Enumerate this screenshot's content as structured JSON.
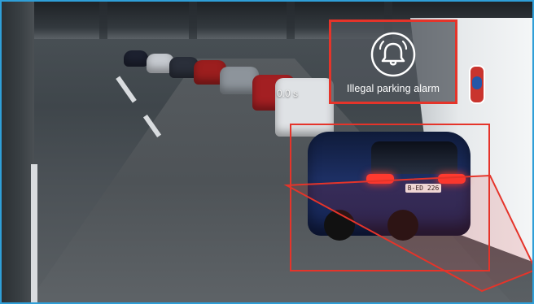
{
  "alarm": {
    "label": "Illegal parking alarm",
    "icon": "alarm-bell-icon"
  },
  "timer": {
    "value": "0.0 s"
  },
  "vehicle": {
    "plate": "B-ED 226"
  },
  "colors": {
    "alert_red": "#e5342a",
    "frame_blue": "#2f9fd8",
    "overlay_grey": "#50565c"
  }
}
